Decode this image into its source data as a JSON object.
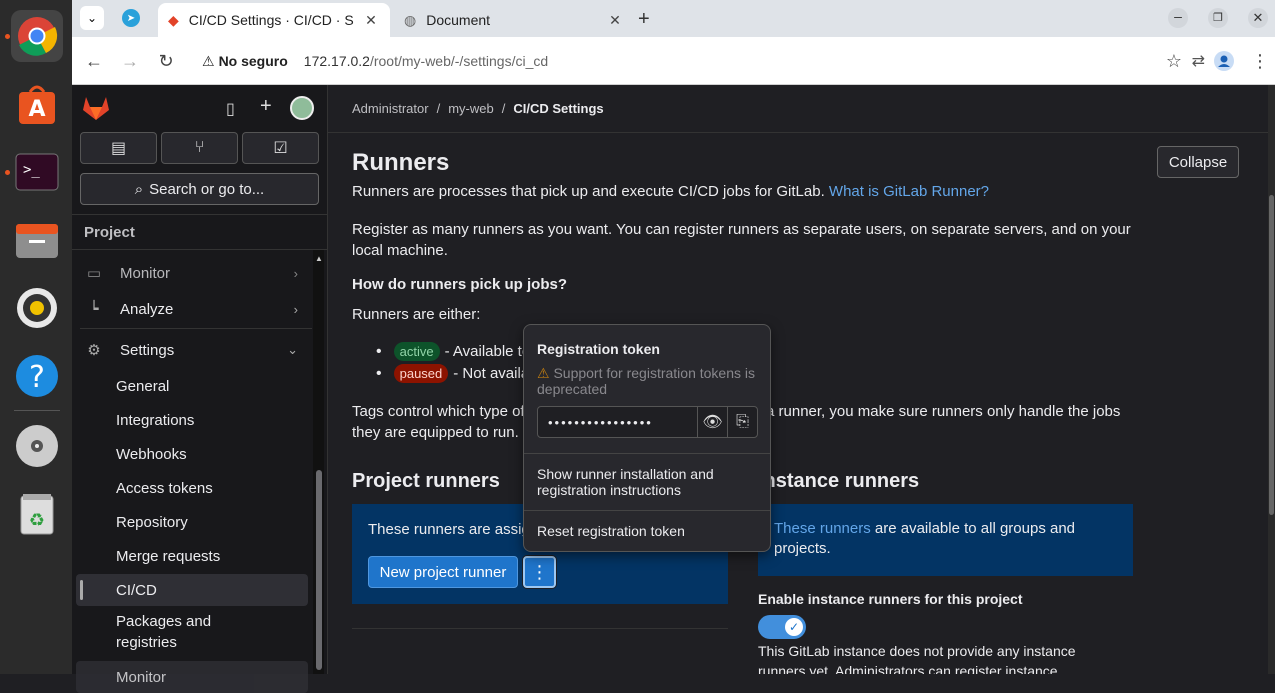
{
  "browser": {
    "tabs": [
      {
        "title": "CI/CD Settings · CI/CD · S",
        "active": true
      },
      {
        "title": "Document",
        "active": false
      }
    ],
    "security_label": "No seguro",
    "url_host": "172.17.0.2",
    "url_path": "/root/my-web/-/settings/ci_cd"
  },
  "sidebar": {
    "search_label": "Search or go to...",
    "section": "Project",
    "items": [
      {
        "label": "Monitor"
      },
      {
        "label": "Analyze"
      },
      {
        "label": "Settings"
      }
    ],
    "sub_items": [
      {
        "label": "General"
      },
      {
        "label": "Integrations"
      },
      {
        "label": "Webhooks"
      },
      {
        "label": "Access tokens"
      },
      {
        "label": "Repository"
      },
      {
        "label": "Merge requests"
      },
      {
        "label": "CI/CD"
      },
      {
        "label": "Packages and registries"
      },
      {
        "label": "Monitor"
      }
    ]
  },
  "breadcrumb": {
    "a": "Administrator",
    "b": "my-web",
    "c": "CI/CD Settings"
  },
  "runners": {
    "title": "Runners",
    "collapse": "Collapse",
    "desc": "Runners are processes that pick up and execute CI/CD jobs for GitLab.",
    "desc_link": "What is GitLab Runner?",
    "register": "Register as many runners as you want. You can register runners as separate users, on separate servers, and on your local machine.",
    "how_title": "How do runners pick up jobs?",
    "either": "Runners are either:",
    "active_badge": "active",
    "active_text": "- Available to",
    "paused_badge": "paused",
    "paused_text": "- Not available",
    "tags_1": "Tags control which type of",
    "tags_2": "a runner, you make sure runners only handle the jobs",
    "tags_3": "they are equipped to run.",
    "project_title": "Project runners",
    "project_panel": "These runners are assig",
    "new_runner": "New project runner",
    "instance_title": "Instance runners",
    "instance_link": "These runners",
    "instance_panel": "are available to all groups and projects.",
    "enable_label": "Enable instance runners for this project",
    "instance_note": "This GitLab instance does not provide any instance runners yet. Administrators can register instance"
  },
  "dropdown": {
    "title": "Registration token",
    "warning": "Support for registration tokens is deprecated",
    "token": "••••••••••••••••",
    "show_instructions": "Show runner installation and registration instructions",
    "reset": "Reset registration token"
  },
  "colors": {
    "accent": "#1f75cb",
    "active_badge": "#0d532a",
    "paused_badge": "#8d1300",
    "panel": "#033464"
  }
}
